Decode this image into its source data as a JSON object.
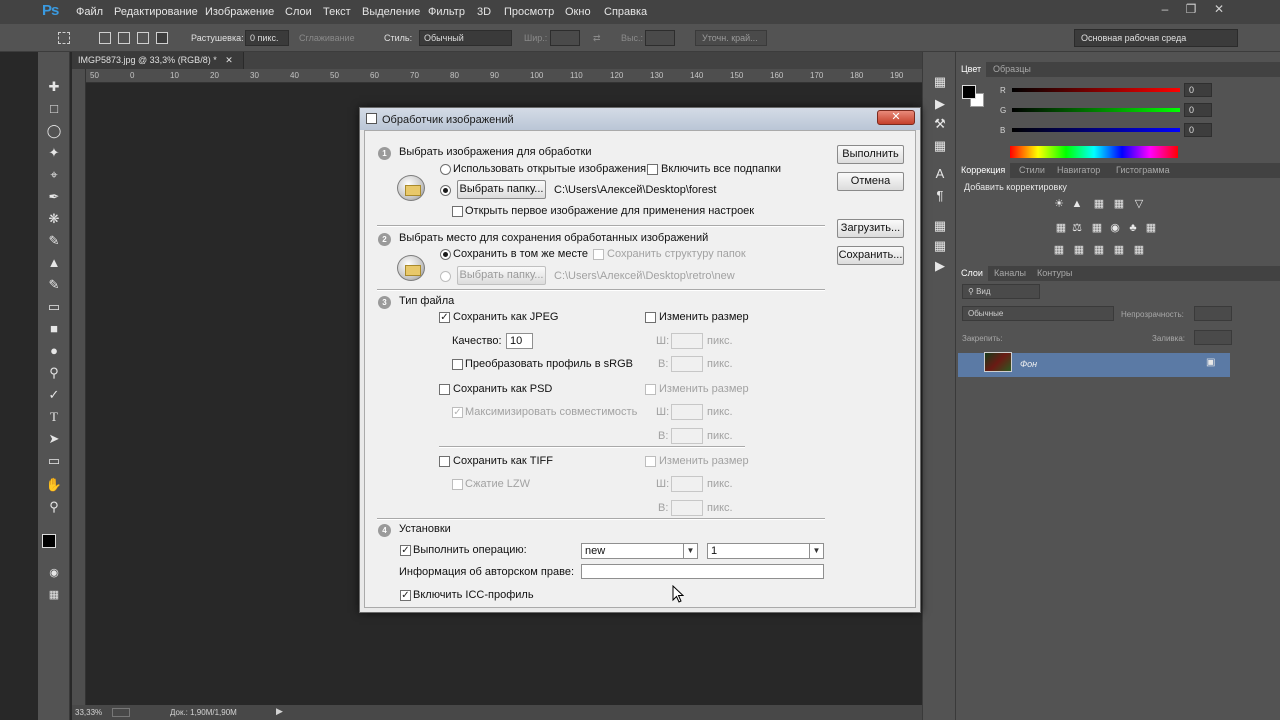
{
  "app": {
    "logo": "Ps",
    "menu": [
      "Файл",
      "Редактирование",
      "Изображение",
      "Слои",
      "Текст",
      "Выделение",
      "Фильтр",
      "3D",
      "Просмотр",
      "Окно",
      "Справка"
    ]
  },
  "options_bar": {
    "feather_label": "Растушевка:",
    "feather_value": "0 пикс.",
    "antialias_label": "Сглаживание",
    "style_label": "Стиль:",
    "style_value": "Обычный",
    "width_label": "Шир.:",
    "height_label": "Выс.:",
    "refine_button": "Уточн. край...",
    "workspace": "Основная рабочая среда"
  },
  "document": {
    "tab_title": "IMGP5873.jpg @ 33,3% (RGB/8) *",
    "ruler_ticks": [
      "50",
      "0",
      "10",
      "20",
      "30",
      "40",
      "50",
      "60",
      "70",
      "80",
      "90",
      "100",
      "110",
      "120",
      "130",
      "140",
      "150",
      "160",
      "170",
      "180",
      "190"
    ],
    "status_zoom": "33,33%",
    "status_doc": "Док.: 1,90M/1,90M"
  },
  "color_panel": {
    "tabs": [
      "Цвет",
      "Образцы"
    ],
    "r_label": "R",
    "r_value": "0",
    "g_label": "G",
    "g_value": "0",
    "b_label": "B",
    "b_value": "0"
  },
  "adjust_panel": {
    "tabs": [
      "Коррекция",
      "Стили",
      "Навигатор",
      "Гистограмма"
    ],
    "title": "Добавить корректировку"
  },
  "layers_panel": {
    "tabs": [
      "Слои",
      "Каналы",
      "Контуры"
    ],
    "kind_label": "Вид",
    "blend_mode": "Обычные",
    "opacity_label": "Непрозрачность:",
    "lock_label": "Закрепить:",
    "fill_label": "Заливка:",
    "layer_name": "Фон"
  },
  "dialog": {
    "title": "Обработчик изображений",
    "run_button": "Выполнить",
    "cancel_button": "Отмена",
    "load_button": "Загрузить...",
    "save_button": "Сохранить...",
    "s1": {
      "num": "1",
      "title": "Выбрать изображения для обработки",
      "use_open": "Использовать открытые изображения",
      "include_sub": "Включить все подпапки",
      "choose_folder": "Выбрать папку...",
      "path": "C:\\Users\\Алексей\\Desktop\\forest",
      "open_first": "Открыть первое изображение для применения настроек"
    },
    "s2": {
      "num": "2",
      "title": "Выбрать место для сохранения обработанных изображений",
      "same_place": "Сохранить в том же месте",
      "keep_structure": "Сохранить структуру папок",
      "choose_folder": "Выбрать папку...",
      "path": "C:\\Users\\Алексей\\Desktop\\retro\\new"
    },
    "s3": {
      "num": "3",
      "title": "Тип файла",
      "jpeg": "Сохранить как JPEG",
      "resize": "Изменить размер",
      "quality_label": "Качество:",
      "quality_value": "10",
      "w_label": "Ш:",
      "h_label": "В:",
      "px": "пикс.",
      "srgb": "Преобразовать профиль в sRGB",
      "psd": "Сохранить как PSD",
      "max_compat": "Максимизировать совместимость",
      "tiff": "Сохранить как TIFF",
      "lzw": "Сжатие LZW"
    },
    "s4": {
      "num": "4",
      "title": "Установки",
      "run_action": "Выполнить операцию:",
      "action_set": "new",
      "action": "1",
      "copyright": "Информация об авторском праве:",
      "icc": "Включить ICC-профиль"
    }
  }
}
